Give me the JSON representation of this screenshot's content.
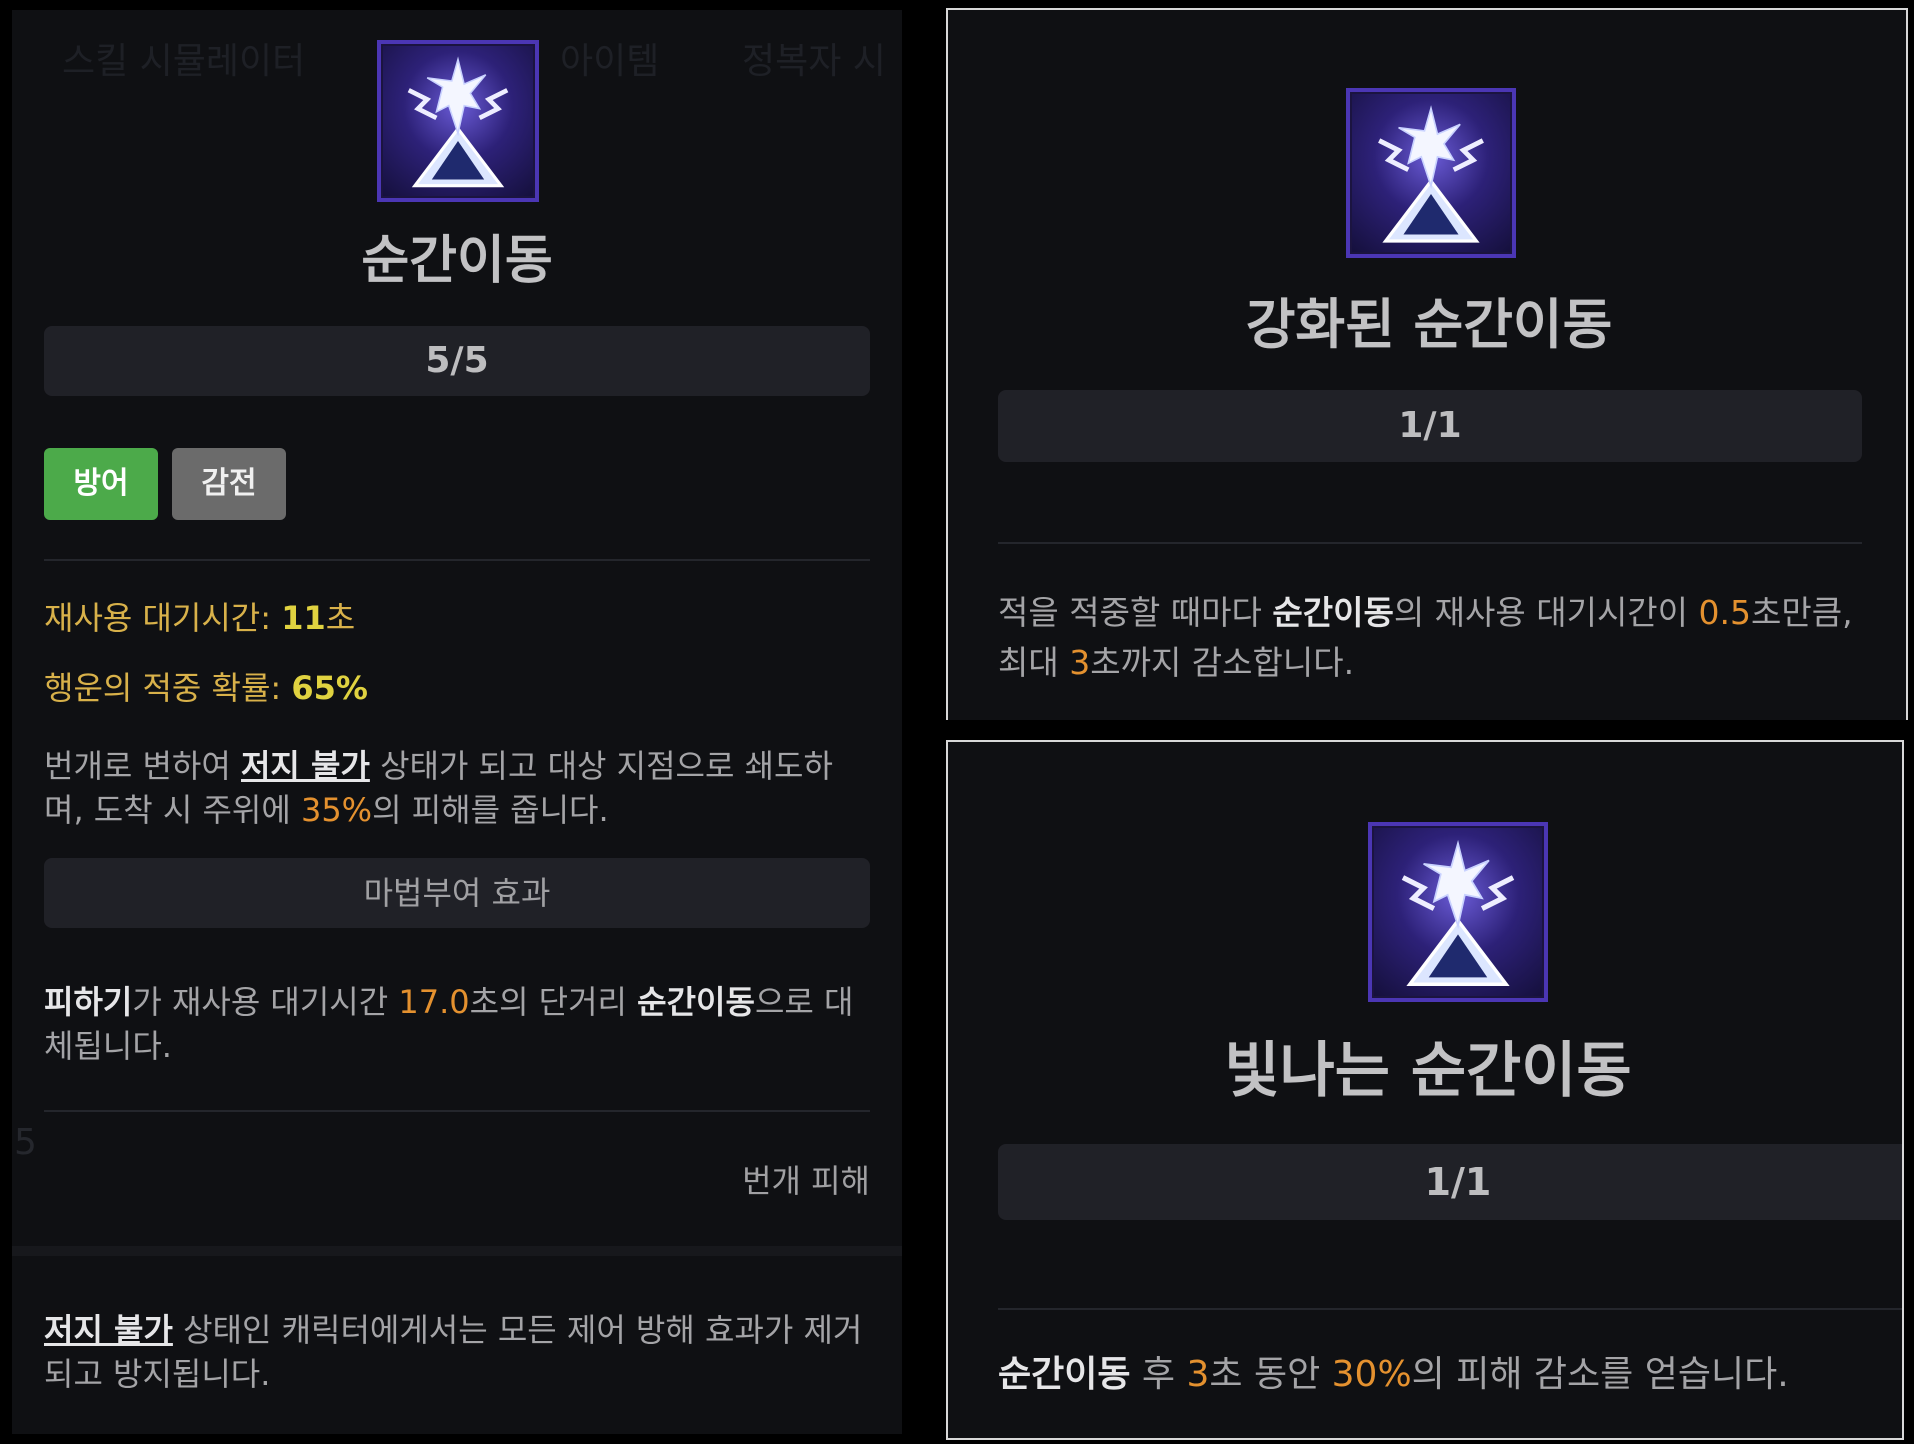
{
  "left": {
    "ghost_tabs": [
      "스킬 시뮬레이터",
      "아이템",
      "정복자 시"
    ],
    "skill_title": "순간이동",
    "rank": "5/5",
    "tags": [
      "방어",
      "감전"
    ],
    "cooldown_label": "재사용 대기시간: ",
    "cooldown_value": "11",
    "cooldown_unit": "초",
    "luck_label": "행운의 적중 확률: ",
    "luck_value": "65%",
    "desc": {
      "part1": "번개로 변하여 ",
      "link": "저지 불가",
      "part2": " 상태가 되고 대상 지점으로 쇄도하며, 도착 시 주위에 ",
      "pct": "35%",
      "part3": "의 피해를 줍니다."
    },
    "enchant_header": "마법부여 효과",
    "enchant": {
      "a": "피하기",
      "b": "가 재사용 대기시간 ",
      "num": "17.0",
      "c": "초의 단거리 ",
      "d": "순간이동",
      "e": "으로 대체됩니다."
    },
    "damage_type": "번개 피해",
    "footer": {
      "link": "저지 불가",
      "rest": " 상태인 캐릭터에게서는 모든 제어 방해 효과가 제거되고 방지됩니다."
    },
    "side_number": "5"
  },
  "top_right": {
    "skill_title": "강화된 순간이동",
    "rank": "1/1",
    "desc": {
      "a": "적을 적중할 때마다 ",
      "b": "순간이동",
      "c": "의 재사용 대기시간이 ",
      "n1": "0.5",
      "d": "초만큼, 최대 ",
      "n2": "3",
      "e": "초까지 감소합니다."
    }
  },
  "bottom_right": {
    "skill_title": "빛나는 순간이동",
    "rank": "1/1",
    "desc": {
      "a": "순간이동",
      "b": " 후 ",
      "n1": "3",
      "c": "초 동안 ",
      "n2": "30%",
      "d": "의 피해 감소를 얻습니다."
    }
  },
  "colors": {
    "accent_orange": "#e4912f",
    "stat_gold": "#d8b14a",
    "tag_green": "#4caa4a",
    "tag_gray": "#6b6b6b",
    "panel_bg": "#0f1013"
  },
  "icons": [
    "teleport-skill-icon"
  ]
}
